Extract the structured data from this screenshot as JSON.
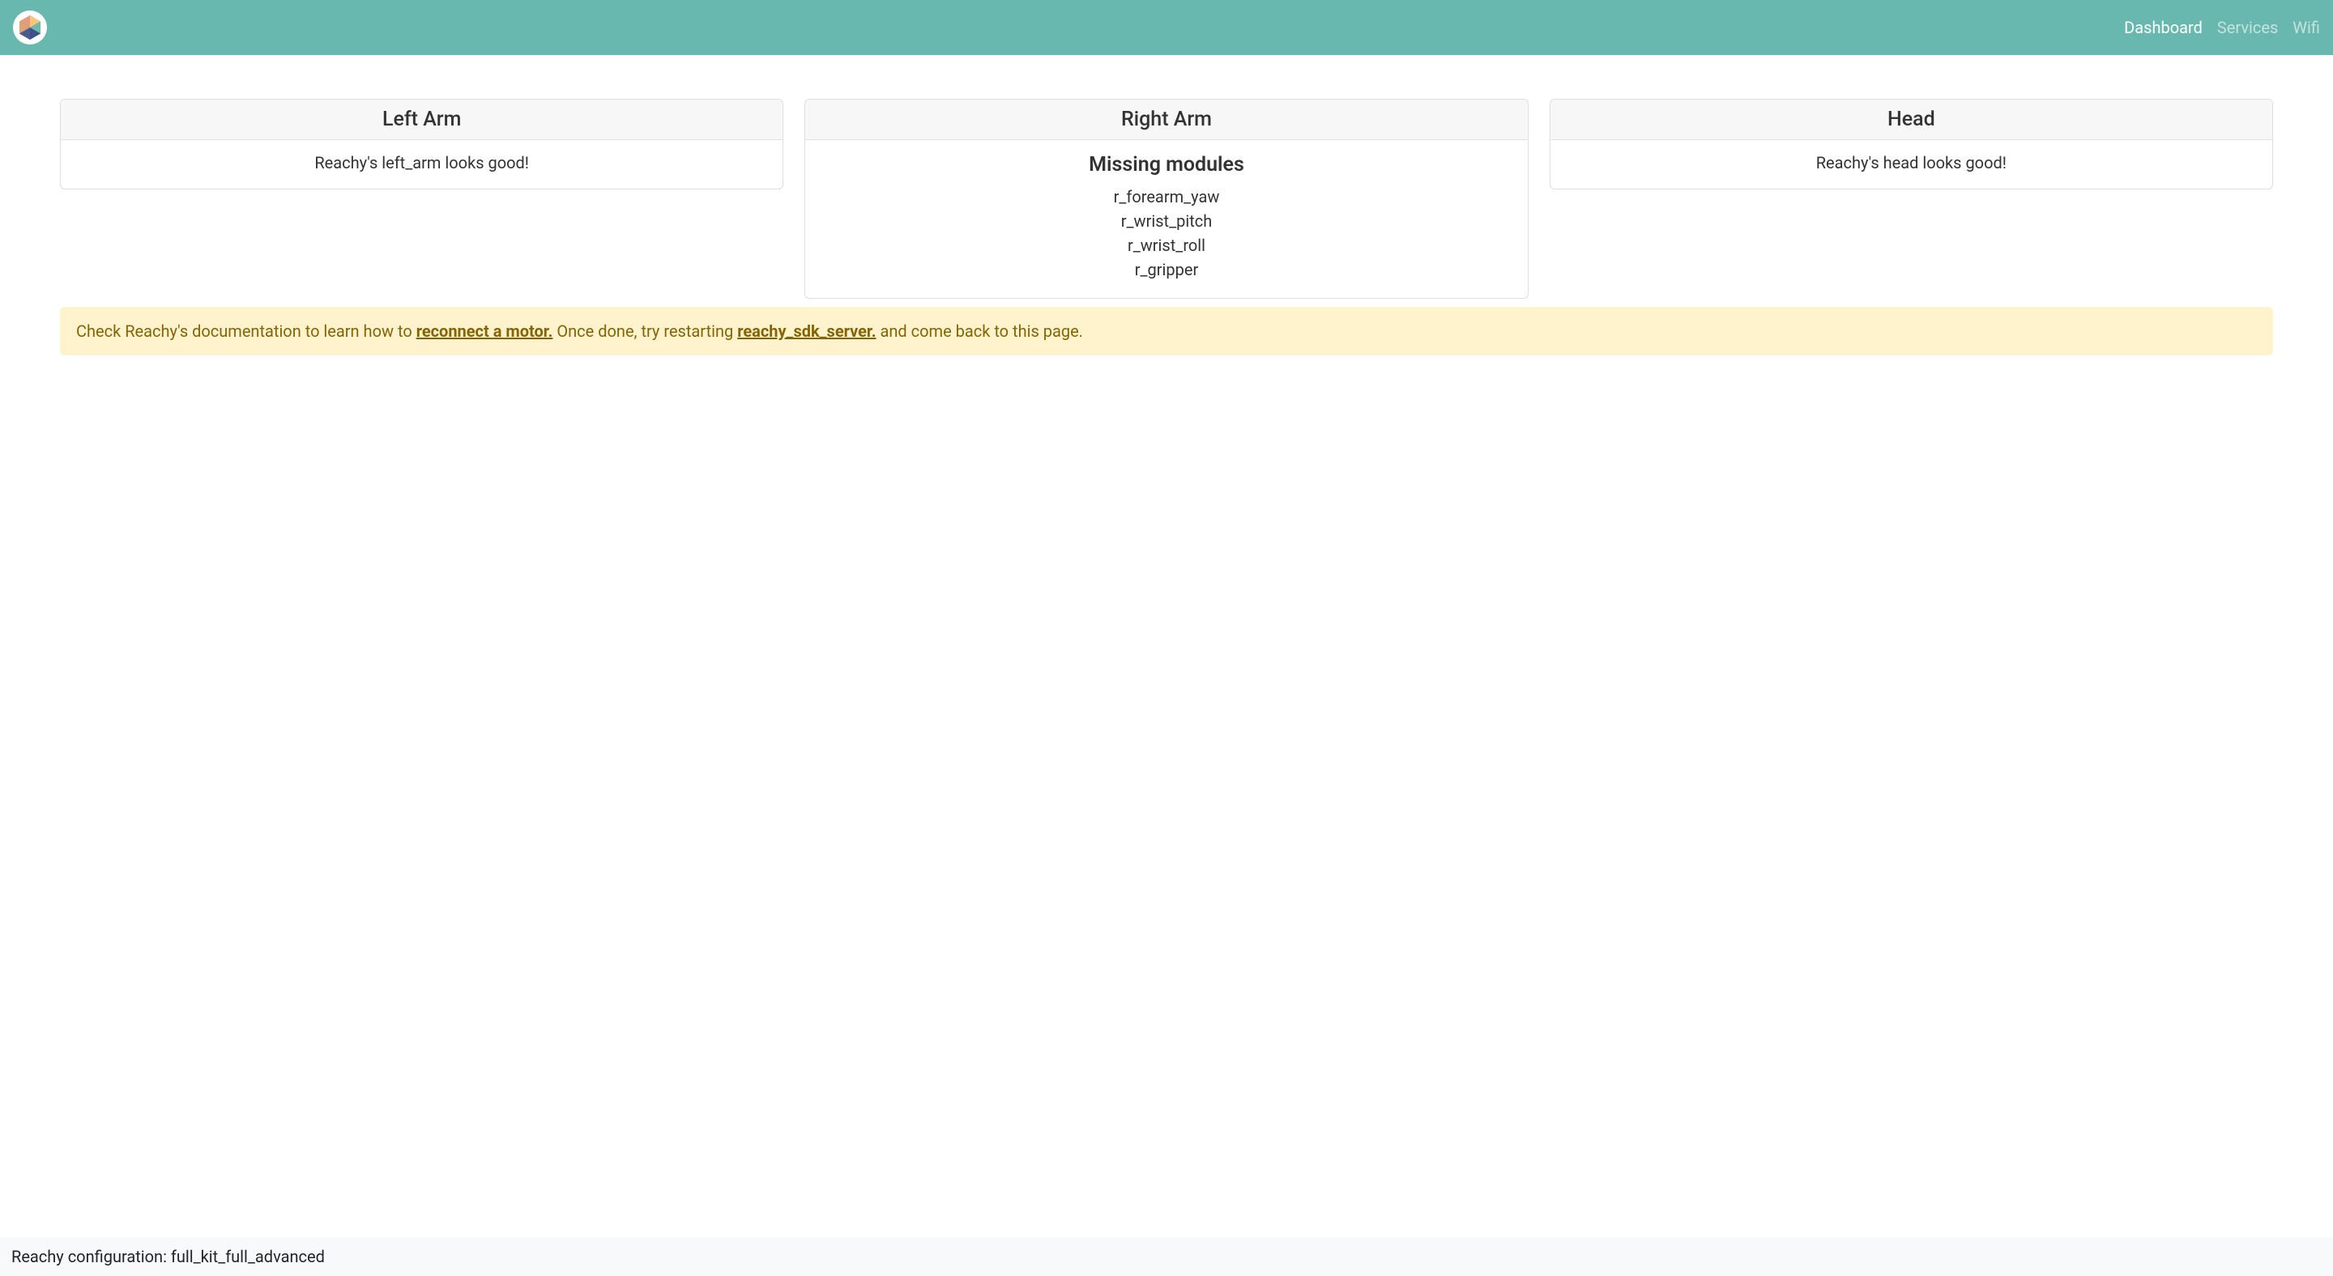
{
  "nav": {
    "dashboard": "Dashboard",
    "services": "Services",
    "wifi": "Wifi"
  },
  "cards": {
    "left_arm": {
      "title": "Left Arm",
      "status": "Reachy's left_arm looks good!"
    },
    "right_arm": {
      "title": "Right Arm",
      "missing_heading": "Missing modules",
      "missing": {
        "item0": "r_forearm_yaw",
        "item1": "r_wrist_pitch",
        "item2": "r_wrist_roll",
        "item3": "r_gripper"
      }
    },
    "head": {
      "title": "Head",
      "status": "Reachy's head looks good!"
    }
  },
  "alert": {
    "prefix": "Check Reachy's documentation to learn how to ",
    "link1": "reconnect a motor.",
    "middle": " Once done, try restarting ",
    "link2": "reachy_sdk_server.",
    "suffix": " and come back to this page."
  },
  "footer": {
    "text": "Reachy configuration: full_kit_full_advanced"
  }
}
